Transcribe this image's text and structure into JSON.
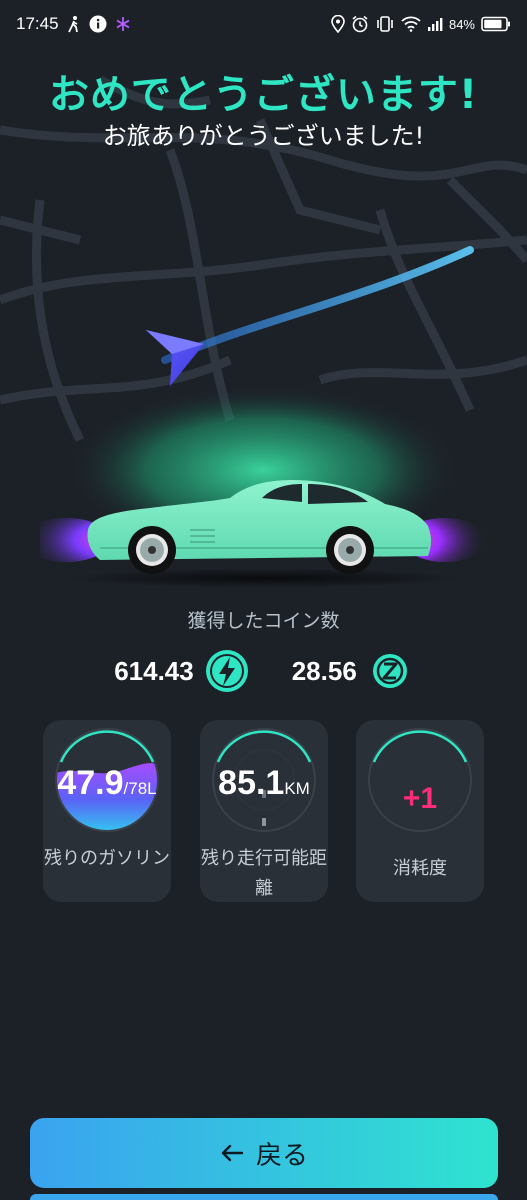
{
  "status_bar": {
    "time": "17:45",
    "icons_left": [
      "walk-icon",
      "info-icon",
      "asterisk-icon"
    ],
    "icons_right": [
      "location-icon",
      "alarm-icon",
      "vibrate-icon",
      "wifi-icon",
      "signal-icon"
    ],
    "battery": "84%",
    "battery_level": 0.84
  },
  "header": {
    "title": "おめでとうございます!",
    "subtitle": "お旅ありがとうございました!"
  },
  "coins": {
    "label": "獲得したコイン数",
    "energy_value": "614.43",
    "energy_icon": "lightning-coin-icon",
    "z_value": "28.56",
    "z_icon": "z-coin-icon"
  },
  "stats": [
    {
      "value": "47.9",
      "unit": "/78L",
      "label": "残りのガソリン",
      "fill_fraction": 0.614
    },
    {
      "value": "85.1",
      "unit": "KM",
      "label": "残り走行可能距離"
    },
    {
      "value": "+1",
      "label": "消耗度"
    }
  ],
  "back_button": {
    "label": "戻る",
    "icon": "arrow-left-icon"
  },
  "colors": {
    "accent": "#2ee6c3",
    "background": "#1c2128",
    "card": "#2a3038",
    "wear": "#ff2d7a",
    "button_start": "#3aa3f0",
    "button_end": "#2fe3cf"
  }
}
